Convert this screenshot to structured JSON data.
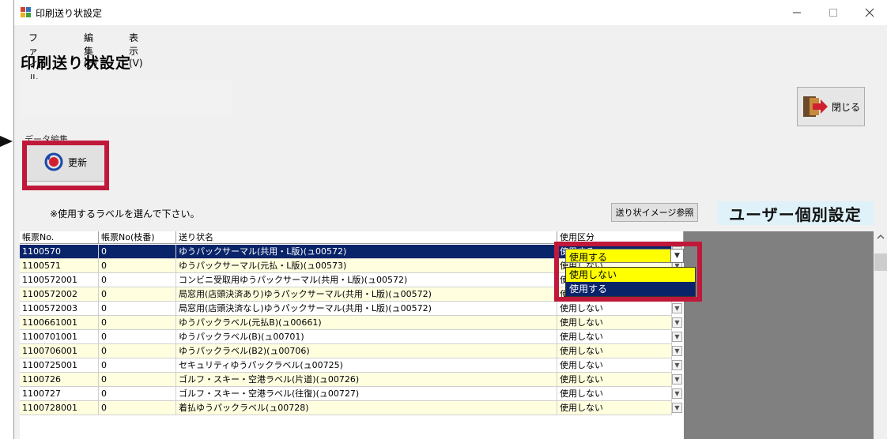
{
  "window": {
    "title": "印刷送り状設定"
  },
  "menu": [
    "ファイル(F)",
    "編集(E)",
    "表示(V)"
  ],
  "page_title": "印刷送り状設定",
  "close_button": "閉じる",
  "group_label": "データ編集",
  "refresh_button": "更新",
  "note": "※使用するラベルを選んで下さい。",
  "preview_button": "送り状イメージ参照",
  "user_label": "ユーザー個別設定",
  "columns": [
    "帳票No.",
    "帳票No(枝番)",
    "送り状名",
    "使用区分"
  ],
  "rows": [
    {
      "no": "1100570",
      "sub": "0",
      "name": "ゆうパックサーマル(共用・L版)(ュ00572)",
      "use": "使用する"
    },
    {
      "no": "1100571",
      "sub": "0",
      "name": "ゆうパックサーマル(元払・L版)(ュ00573)",
      "use": "使用しない"
    },
    {
      "no": "1100572001",
      "sub": "0",
      "name": "コンビニ受取用ゆうパックサーマル(共用・L版)(ュ00572)",
      "use": "使用しない"
    },
    {
      "no": "1100572002",
      "sub": "0",
      "name": "局窓用(店頭決済あり)ゆうパックサーマル(共用・L版)(ュ00572)",
      "use": "使用しない"
    },
    {
      "no": "1100572003",
      "sub": "0",
      "name": "局窓用(店頭決済なし)ゆうパックサーマル(共用・L版)(ュ00572)",
      "use": "使用しない"
    },
    {
      "no": "1100661001",
      "sub": "0",
      "name": "ゆうパックラベル(元払B)(ュ00661)",
      "use": "使用しない"
    },
    {
      "no": "1100701001",
      "sub": "0",
      "name": "ゆうパックラベル(B)(ュ00701)",
      "use": "使用しない"
    },
    {
      "no": "1100706001",
      "sub": "0",
      "name": "ゆうパックラベル(B2)(ュ00706)",
      "use": "使用しない"
    },
    {
      "no": "1100725001",
      "sub": "0",
      "name": "セキュリティゆうパックラベル(ュ00725)",
      "use": "使用しない"
    },
    {
      "no": "1100726",
      "sub": "0",
      "name": "ゴルフ・スキー・空港ラベル(片道)(ュ00726)",
      "use": "使用しない"
    },
    {
      "no": "1100727",
      "sub": "0",
      "name": "ゴルフ・スキー・空港ラベル(往復)(ュ00727)",
      "use": "使用しない"
    },
    {
      "no": "1100728001",
      "sub": "0",
      "name": "着払ゆうパックラベル(ュ00728)",
      "use": "使用しない"
    }
  ],
  "dropdown": {
    "selected": "使用する",
    "options": [
      "使用しない",
      "使用する"
    ]
  },
  "colors": {
    "highlight": "#c0183a",
    "selected_row": "#0a246a",
    "alt_row": "#ffffe0",
    "yellow": "#ffff00"
  }
}
